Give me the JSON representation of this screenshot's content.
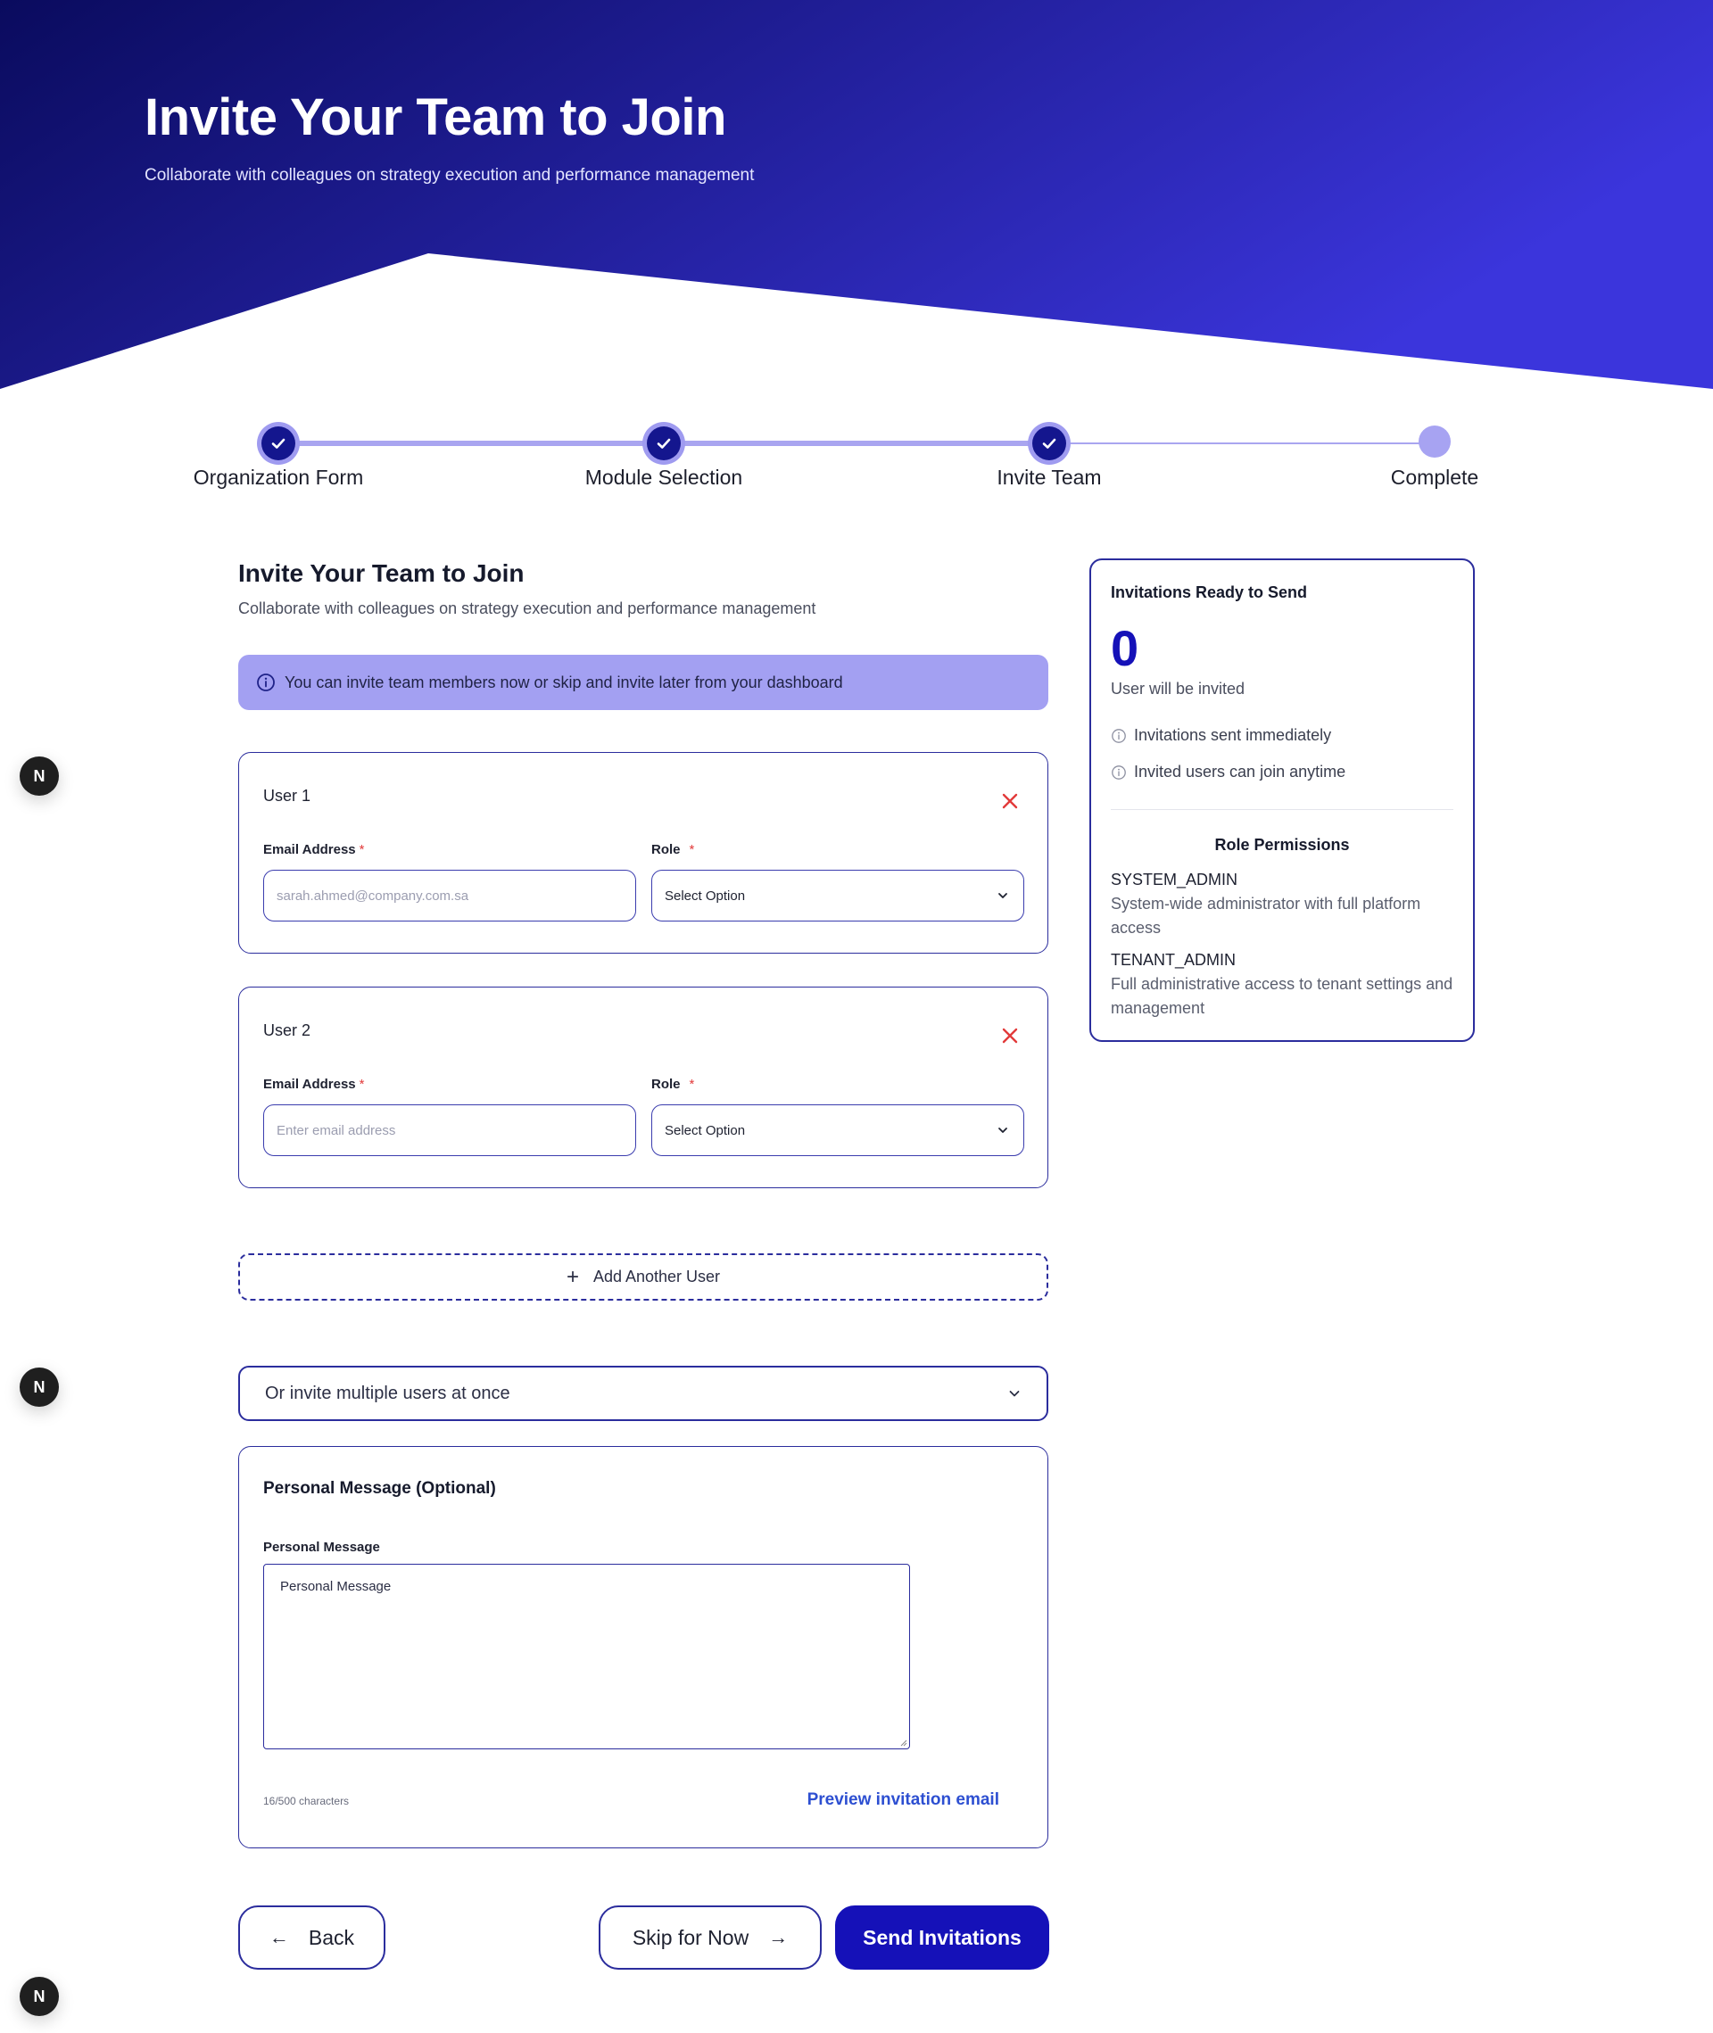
{
  "hero": {
    "title": "Invite Your Team to Join",
    "subtitle": "Collaborate with colleagues on strategy execution and performance management"
  },
  "stepper": {
    "steps": [
      {
        "label": "Organization Form",
        "status": "done"
      },
      {
        "label": "Module Selection",
        "status": "done"
      },
      {
        "label": "Invite Team",
        "status": "done"
      },
      {
        "label": "Complete",
        "status": "pending"
      }
    ]
  },
  "section": {
    "title": "Invite Your Team to Join",
    "subtitle": "Collaborate with colleagues on strategy execution and performance management",
    "info": "You can invite team members now or skip and invite later from your dashboard"
  },
  "users": [
    {
      "title": "User 1",
      "email_label": "Email Address",
      "email_placeholder": "sarah.ahmed@company.com.sa",
      "role_label": "Role",
      "role_value": "Select Option"
    },
    {
      "title": "User 2",
      "email_label": "Email Address",
      "email_placeholder": "Enter email address",
      "role_label": "Role",
      "role_value": "Select Option"
    }
  ],
  "required_mark": "*",
  "add_user_label": "Add Another User",
  "multi_invite_label": "Or invite multiple users at once",
  "message": {
    "title": "Personal Message (Optional)",
    "label": "Personal Message",
    "placeholder": "Personal Message",
    "char_count": "16/500 characters",
    "preview_link": "Preview invitation email"
  },
  "actions": {
    "back": "Back",
    "skip": "Skip for Now",
    "send": "Send Invitations",
    "back_arrow": "←",
    "skip_arrow": "→"
  },
  "summary": {
    "title": "Invitations Ready to Send",
    "count": "0",
    "count_label": "User will be invited",
    "notes": [
      "Invitations sent immediately",
      "Invited users can join anytime"
    ],
    "permissions_title": "Role Permissions",
    "roles": [
      {
        "name": "SYSTEM_ADMIN",
        "description": "System-wide administrator with full platform access"
      },
      {
        "name": "TENANT_ADMIN",
        "description": "Full administrative access to tenant settings and management"
      }
    ]
  },
  "badge_letter": "N",
  "colors": {
    "hero_start": "#0a0b5e",
    "hero_end": "#3b35dc",
    "primary": "#1511b8",
    "border": "#2b2d9d",
    "banner": "#a3a0f2",
    "remove": "#e23a3a",
    "link": "#2d4fd1"
  }
}
